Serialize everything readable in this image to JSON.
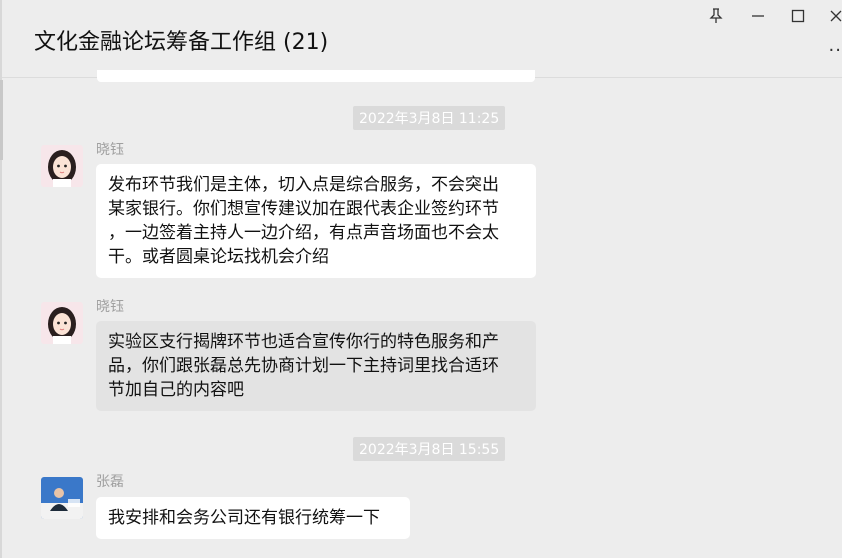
{
  "header": {
    "title": "文化金融论坛筹备工作组 (21)",
    "controls": {
      "pin": "pin-icon",
      "minimize": "minimize-icon",
      "maximize": "maximize-icon",
      "close": "close-icon",
      "more": "more-icon"
    }
  },
  "messages": [
    {
      "type": "time",
      "text": "2022年3月8日 11:25"
    },
    {
      "type": "msg",
      "sender": "晓钰",
      "lines": [
        "发布环节我们是主体，切入点是综合服务，不会突出",
        "某家银行。你们想宣传建议加在跟代表企业签约环节",
        "，一边签着主持人一边介绍，有点声音场面也不会太",
        "干。或者圆桌论坛找机会介绍"
      ]
    },
    {
      "type": "msg",
      "sender": "晓钰",
      "lines": [
        "实验区支行揭牌环节也适合宣传你行的特色服务和产",
        "品，你们跟张磊总先协商计划一下主持词里找合适环",
        "节加自己的内容吧"
      ]
    },
    {
      "type": "time",
      "text": "2022年3月8日 15:55"
    },
    {
      "type": "msg",
      "sender": "张磊",
      "lines": [
        "我安排和会务公司还有银行统筹一下"
      ]
    }
  ]
}
